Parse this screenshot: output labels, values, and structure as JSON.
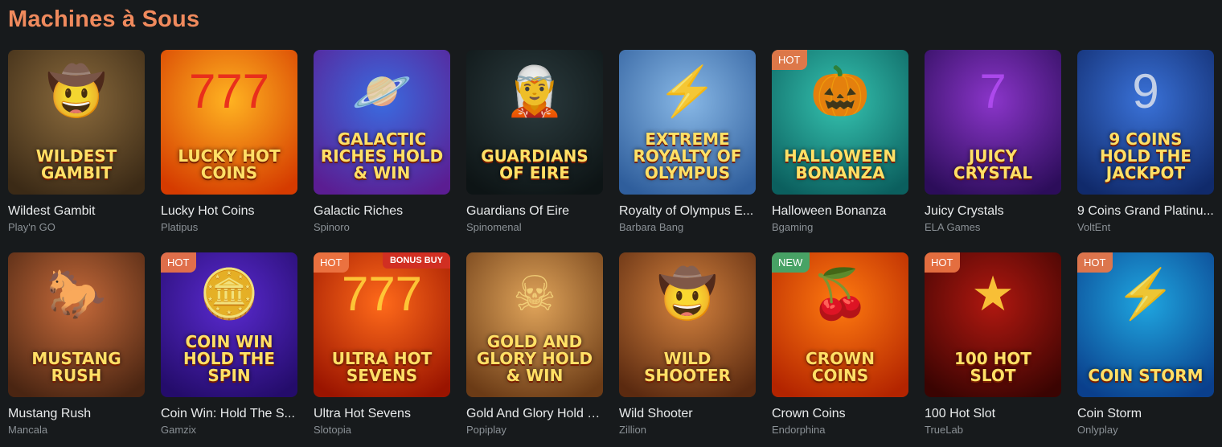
{
  "section": {
    "title": "Machines à Sous"
  },
  "games": [
    {
      "name": "Wildest Gambit",
      "provider": "Play'n GO",
      "logo": "Wildest Gambit",
      "badge": "",
      "bonus": "",
      "bg": [
        "#8a6a3c",
        "#3b2a16"
      ],
      "art": "🤠",
      "artColor": "#f2c26b"
    },
    {
      "name": "Lucky Hot Coins",
      "provider": "Platipus",
      "logo": "Lucky Hot Coins",
      "badge": "",
      "bonus": "",
      "bg": [
        "#ffb321",
        "#d53b00"
      ],
      "art": "777",
      "artColor": "#e8271d"
    },
    {
      "name": "Galactic Riches",
      "provider": "Spinoro",
      "logo": "Galactic Riches Hold & Win",
      "badge": "",
      "bonus": "",
      "bg": [
        "#3a6be0",
        "#5b1d92"
      ],
      "art": "🪐",
      "artColor": "#ffffff"
    },
    {
      "name": "Guardians Of Eire",
      "provider": "Spinomenal",
      "logo": "Guardians of Eire",
      "badge": "",
      "bonus": "",
      "bg": [
        "#2b3b3e",
        "#0d1415"
      ],
      "art": "🧝",
      "artColor": "#8fa0a3"
    },
    {
      "name": "Royalty of Olympus E...",
      "provider": "Barbara Bang",
      "logo": "extreme Royalty of Olympus",
      "badge": "",
      "bonus": "",
      "bg": [
        "#88b8e6",
        "#2f5e9c"
      ],
      "art": "⚡",
      "artColor": "#f6d66a"
    },
    {
      "name": "Halloween Bonanza",
      "provider": "Bgaming",
      "logo": "Halloween Bonanza",
      "badge": "HOT",
      "bonus": "",
      "bg": [
        "#35c3b0",
        "#0b5f5e"
      ],
      "art": "🎃",
      "artColor": "#ff7a1a"
    },
    {
      "name": "Juicy Crystals",
      "provider": "ELA Games",
      "logo": "Juicy Crystal",
      "badge": "",
      "bonus": "",
      "bg": [
        "#8a35c9",
        "#2c0d5a"
      ],
      "art": "7",
      "artColor": "#b04bf0"
    },
    {
      "name": "9 Coins Grand Platinu...",
      "provider": "VoltEnt",
      "logo": "9 Coins Hold the Jackpot",
      "badge": "",
      "bonus": "",
      "bg": [
        "#3a72d8",
        "#102a6b"
      ],
      "art": "9",
      "artColor": "#cfd8ea"
    },
    {
      "name": "Mustang Rush",
      "provider": "Mancala",
      "logo": "Mustang Rush",
      "badge": "",
      "bonus": "",
      "bg": [
        "#c66a3a",
        "#4a2512"
      ],
      "art": "🐎",
      "artColor": "#f0b160"
    },
    {
      "name": "Coin Win: Hold The S...",
      "provider": "Gamzix",
      "logo": "Coin Win Hold the Spin",
      "badge": "HOT",
      "bonus": "",
      "bg": [
        "#5a2ad0",
        "#240c6b"
      ],
      "art": "🪙",
      "artColor": "#ffd23f"
    },
    {
      "name": "Ultra Hot Sevens",
      "provider": "Slotopia",
      "logo": "Ultra Hot Sevens",
      "badge": "HOT",
      "bonus": "BONUS BUY",
      "bg": [
        "#ff6a1a",
        "#9a1400"
      ],
      "art": "777",
      "artColor": "#ffcf3a"
    },
    {
      "name": "Gold And Glory Hold a...",
      "provider": "Popiplay",
      "logo": "Gold and Glory Hold & Win",
      "badge": "",
      "bonus": "",
      "bg": [
        "#e0a45a",
        "#6b3b16"
      ],
      "art": "☠",
      "artColor": "#f3d27a"
    },
    {
      "name": "Wild Shooter",
      "provider": "Zillion",
      "logo": "Wild Shooter",
      "badge": "",
      "bonus": "",
      "bg": [
        "#d4823e",
        "#5b2a10"
      ],
      "art": "🤠",
      "artColor": "#f0c68a"
    },
    {
      "name": "Crown Coins",
      "provider": "Endorphina",
      "logo": "Crown Coins",
      "badge": "NEW",
      "bonus": "",
      "bg": [
        "#ff7a10",
        "#b32400"
      ],
      "art": "🍒",
      "artColor": "#ffd23f"
    },
    {
      "name": "100 Hot Slot",
      "provider": "TrueLab",
      "logo": "100 Hot Slot",
      "badge": "HOT",
      "bonus": "",
      "bg": [
        "#b01810",
        "#3a0402"
      ],
      "art": "★",
      "artColor": "#ffcf3a"
    },
    {
      "name": "Coin Storm",
      "provider": "Onlyplay",
      "logo": "Coin Storm",
      "badge": "HOT",
      "bonus": "",
      "bg": [
        "#1fa6e0",
        "#0a3f8c"
      ],
      "art": "⚡",
      "artColor": "#ffe35a"
    }
  ]
}
